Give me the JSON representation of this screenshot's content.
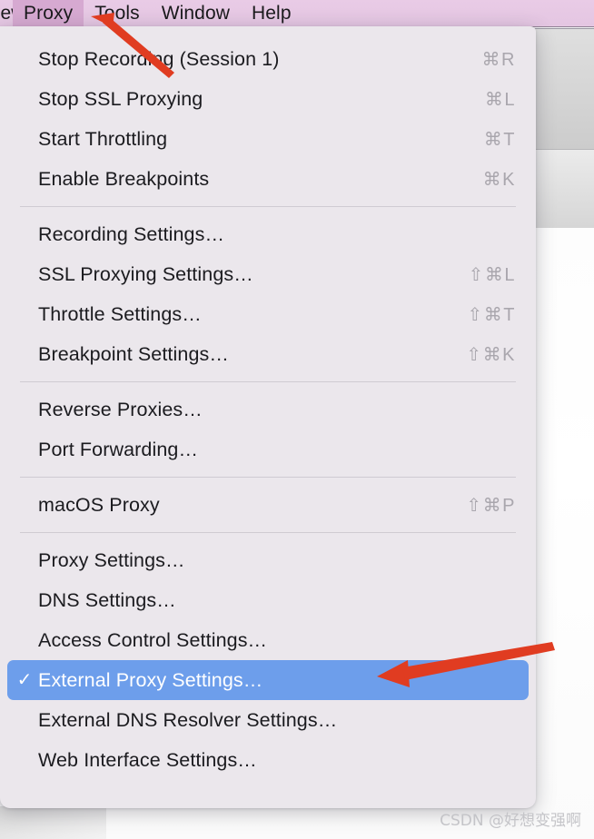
{
  "menubar": {
    "items": [
      {
        "label": "View",
        "active": false,
        "clipped": true
      },
      {
        "label": "Proxy",
        "active": true,
        "clipped": false
      },
      {
        "label": "Tools",
        "active": false,
        "clipped": false
      },
      {
        "label": "Window",
        "active": false,
        "clipped": false
      },
      {
        "label": "Help",
        "active": false,
        "clipped": false
      }
    ],
    "background_color": "#e4c6e2",
    "active_color": "#d6a9d1"
  },
  "dropdown": {
    "owner": "Proxy",
    "background_color": "#ebe7ec",
    "highlight_color": "#6d9eeb",
    "groups": [
      {
        "items": [
          {
            "label": "Stop Recording (Session 1)",
            "shortcut": "⌘R",
            "checked": false,
            "selected": false
          },
          {
            "label": "Stop SSL Proxying",
            "shortcut": "⌘L",
            "checked": false,
            "selected": false
          },
          {
            "label": "Start Throttling",
            "shortcut": "⌘T",
            "checked": false,
            "selected": false
          },
          {
            "label": "Enable Breakpoints",
            "shortcut": "⌘K",
            "checked": false,
            "selected": false
          }
        ]
      },
      {
        "items": [
          {
            "label": "Recording Settings…",
            "shortcut": "",
            "checked": false,
            "selected": false
          },
          {
            "label": "SSL Proxying Settings…",
            "shortcut": "⇧⌘L",
            "checked": false,
            "selected": false
          },
          {
            "label": "Throttle Settings…",
            "shortcut": "⇧⌘T",
            "checked": false,
            "selected": false
          },
          {
            "label": "Breakpoint Settings…",
            "shortcut": "⇧⌘K",
            "checked": false,
            "selected": false
          }
        ]
      },
      {
        "items": [
          {
            "label": "Reverse Proxies…",
            "shortcut": "",
            "checked": false,
            "selected": false
          },
          {
            "label": "Port Forwarding…",
            "shortcut": "",
            "checked": false,
            "selected": false
          }
        ]
      },
      {
        "items": [
          {
            "label": "macOS Proxy",
            "shortcut": "⇧⌘P",
            "checked": false,
            "selected": false
          }
        ]
      },
      {
        "items": [
          {
            "label": "Proxy Settings…",
            "shortcut": "",
            "checked": false,
            "selected": false
          },
          {
            "label": "DNS Settings…",
            "shortcut": "",
            "checked": false,
            "selected": false
          },
          {
            "label": "Access Control Settings…",
            "shortcut": "",
            "checked": false,
            "selected": false
          },
          {
            "label": "External Proxy Settings…",
            "shortcut": "",
            "checked": true,
            "selected": true
          },
          {
            "label": "External DNS Resolver Settings…",
            "shortcut": "",
            "checked": false,
            "selected": false
          },
          {
            "label": "Web Interface Settings…",
            "shortcut": "",
            "checked": false,
            "selected": false
          }
        ]
      }
    ]
  },
  "annotations": {
    "color": "#e03c21",
    "arrows": [
      {
        "name": "arrow-pointing-to-proxy-menu"
      },
      {
        "name": "arrow-pointing-to-external-proxy-settings"
      }
    ]
  },
  "watermark": {
    "text": "CSDN @好想变强啊"
  }
}
